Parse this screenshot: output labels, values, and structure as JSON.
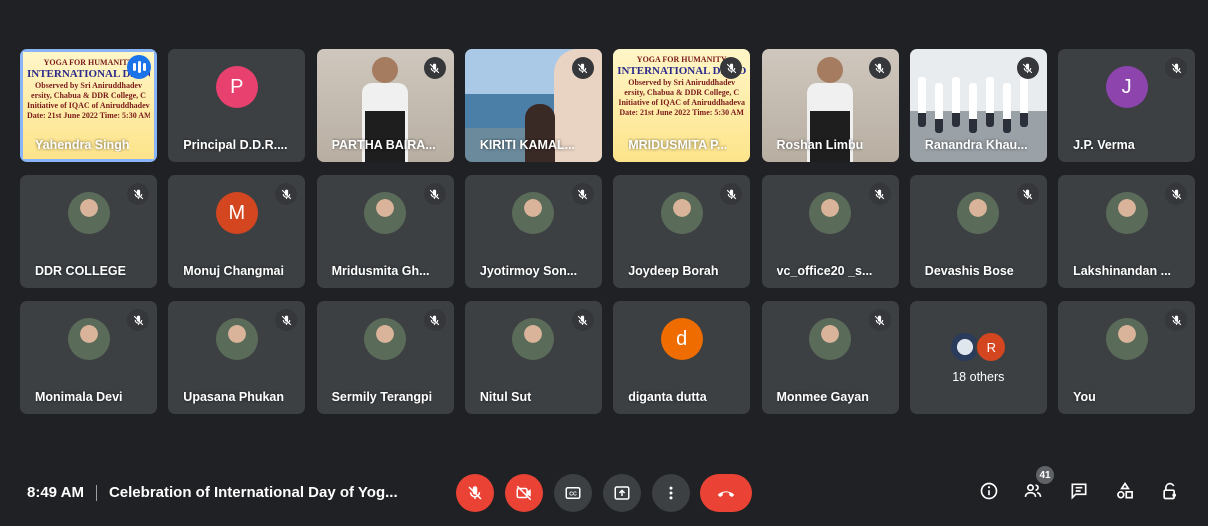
{
  "tiles": [
    {
      "name": "Yahendra Singh",
      "type": "poster",
      "muted": false,
      "speaking": true
    },
    {
      "name": "Principal D.D.R....",
      "type": "letter",
      "letter": "P",
      "color": "#e8416f",
      "muted": false
    },
    {
      "name": "PARTHA BAIRA...",
      "type": "video-person",
      "muted": true
    },
    {
      "name": "KIRITI KAMAL...",
      "type": "video-sea",
      "muted": true
    },
    {
      "name": "MRIDUSMITA P...",
      "type": "poster",
      "muted": true
    },
    {
      "name": "Roshan Limbu",
      "type": "video-person",
      "muted": true
    },
    {
      "name": "Ranandra Khau...",
      "type": "video-group",
      "muted": true
    },
    {
      "name": "J.P. Verma",
      "type": "letter",
      "letter": "J",
      "color": "#8e44ad",
      "muted": true
    },
    {
      "name": "DDR COLLEGE",
      "type": "photo",
      "muted": true
    },
    {
      "name": "Monuj Changmai",
      "type": "letter",
      "letter": "M",
      "color": "#d3461f",
      "muted": true
    },
    {
      "name": "Mridusmita Gh...",
      "type": "photo",
      "muted": true
    },
    {
      "name": "Jyotirmoy Son...",
      "type": "photo",
      "muted": true
    },
    {
      "name": "Joydeep Borah",
      "type": "photo",
      "muted": true
    },
    {
      "name": "vc_office20 _s...",
      "type": "photo",
      "muted": true
    },
    {
      "name": "Devashis Bose",
      "type": "photo",
      "muted": true
    },
    {
      "name": "Lakshinandan ...",
      "type": "photo",
      "muted": true
    },
    {
      "name": "Monimala Devi",
      "type": "photo",
      "muted": true
    },
    {
      "name": "Upasana Phukan",
      "type": "photo",
      "muted": true
    },
    {
      "name": "Sermily Terangpi",
      "type": "photo",
      "muted": true
    },
    {
      "name": "Nitul Sut",
      "type": "photo",
      "muted": true
    },
    {
      "name": "diganta dutta",
      "type": "letter",
      "letter": "d",
      "color": "#ef6c00",
      "muted": false
    },
    {
      "name": "Monmee Gayan",
      "type": "photo",
      "muted": true
    },
    {
      "name": "18 others",
      "type": "others",
      "letter": "R",
      "color": "#d3461f",
      "muted": false
    },
    {
      "name": "You",
      "type": "photo",
      "muted": true
    }
  ],
  "poster_lines": [
    "YOGA FOR HUMANITY",
    "INTERNATIONAL DAY OF",
    "Observed by Sri Aniruddhadev",
    "ersity, Chabua & DDR College, C",
    "Initiative of IQAC of Aniruddhadeva",
    "Date: 21st June 2022 Time: 5:30 AM"
  ],
  "bottom": {
    "time": "8:49 AM",
    "meeting_title": "Celebration of International Day of Yog...",
    "participants_count": "41"
  },
  "controls": [
    "mic-off",
    "camera-off",
    "captions",
    "present",
    "more",
    "hang-up"
  ],
  "right_icons": [
    "info",
    "people",
    "chat",
    "activities",
    "host-controls"
  ],
  "colors": {
    "background": "#202124",
    "tile": "#3c4043",
    "red": "#ea4335"
  }
}
